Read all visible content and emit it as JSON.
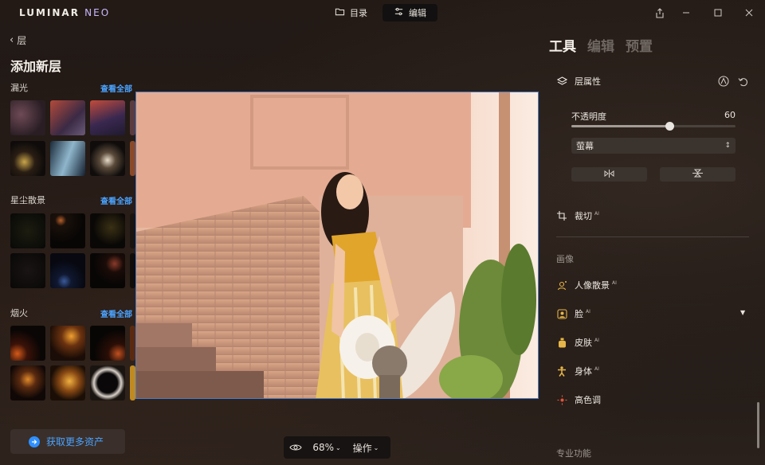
{
  "app": {
    "logo_main": "LUMINAR",
    "logo_accent": "NEO"
  },
  "top_tabs": [
    {
      "label": "目录",
      "icon": "folder-icon",
      "active": false
    },
    {
      "label": "编辑",
      "icon": "sliders-icon",
      "active": true
    }
  ],
  "window_controls": [
    "share-icon",
    "minimize-icon",
    "maximize-icon",
    "close-icon"
  ],
  "left_panel": {
    "back_label": "层",
    "title": "添加新层",
    "sections": [
      {
        "label": "漏光",
        "view_all": "查看全部"
      },
      {
        "label": "星尘散景",
        "view_all": "查看全部"
      },
      {
        "label": "烟火",
        "view_all": "查看全部"
      }
    ],
    "get_more_label": "获取更多资产"
  },
  "bottom_bar": {
    "zoom": "68%",
    "actions_label": "操作"
  },
  "right_panel": {
    "tabs": [
      {
        "label": "工具",
        "active": true
      },
      {
        "label": "编辑",
        "active": false
      },
      {
        "label": "预置",
        "active": false
      }
    ],
    "layer_props": {
      "title": "层属性",
      "opacity_label": "不透明度",
      "opacity_value": "60",
      "opacity_fraction": 0.6,
      "blend_mode": "萤幕"
    },
    "crop": {
      "label": "裁切",
      "ai": "AI"
    },
    "image_section": "画像",
    "tools": [
      {
        "label": "人像散景",
        "ai": "AI",
        "icon": "portrait-bokeh-icon"
      },
      {
        "label": "脸",
        "ai": "AI",
        "icon": "face-icon"
      },
      {
        "label": "皮肤",
        "ai": "AI",
        "icon": "skin-icon"
      },
      {
        "label": "身体",
        "ai": "AI",
        "icon": "body-icon"
      },
      {
        "label": "高色调",
        "ai": "",
        "icon": "high-key-icon"
      }
    ],
    "pro_section": "专业功能"
  },
  "colors": {
    "accent": "#4aa3ff",
    "photo_border": "#4a7cc9"
  }
}
